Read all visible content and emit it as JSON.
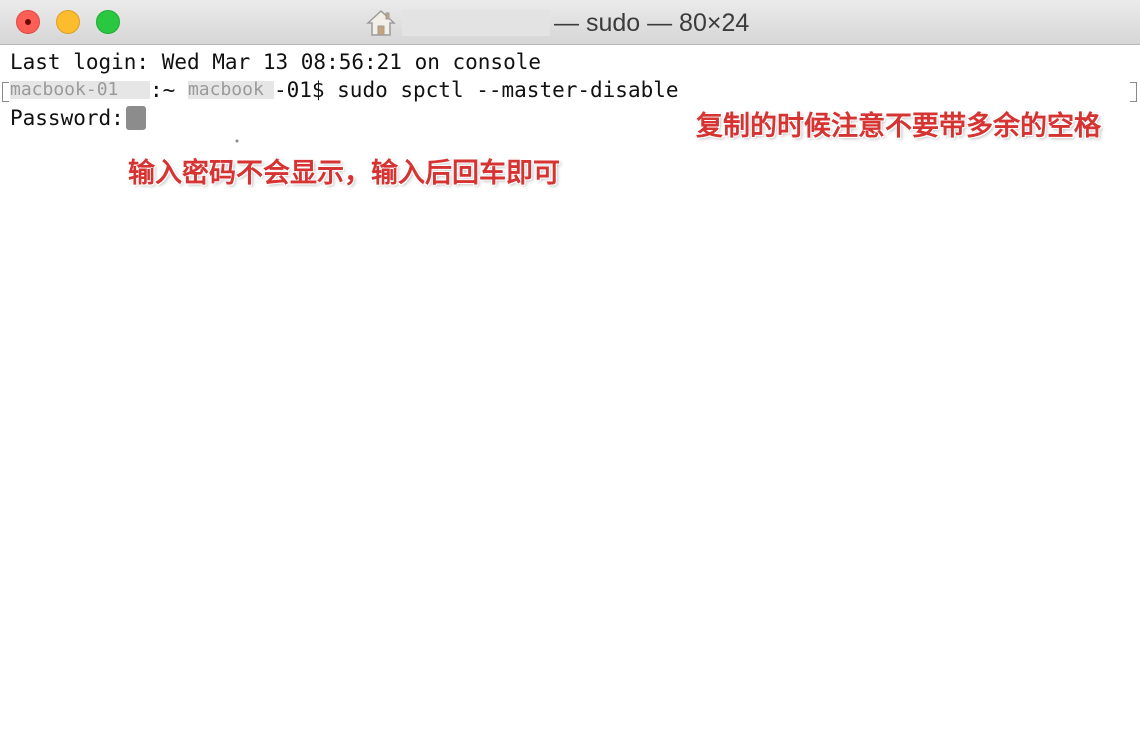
{
  "window": {
    "title": "— sudo — 80×24",
    "icon": "home-icon",
    "title_redacted": true
  },
  "terminal": {
    "last_login": "Last login: Wed Mar 13 08:56:21 on console",
    "prompt_host_redacted": "macbook-01",
    "prompt_sep": ":~ ",
    "prompt_user_redacted": "macbook",
    "prompt_suffix": "-01$ ",
    "command": "sudo spctl --master-disable",
    "password_label": "Password:",
    "cursor_icon": "key-icon"
  },
  "annotations": {
    "copy_note": "复制的时候注意不要带多余的空格",
    "password_note": "输入密码不会显示，输入后回车即可"
  },
  "colors": {
    "annotation": "#d63333",
    "close": "#fd5f57",
    "minimize": "#fdbb2e",
    "maximize": "#29c840"
  }
}
